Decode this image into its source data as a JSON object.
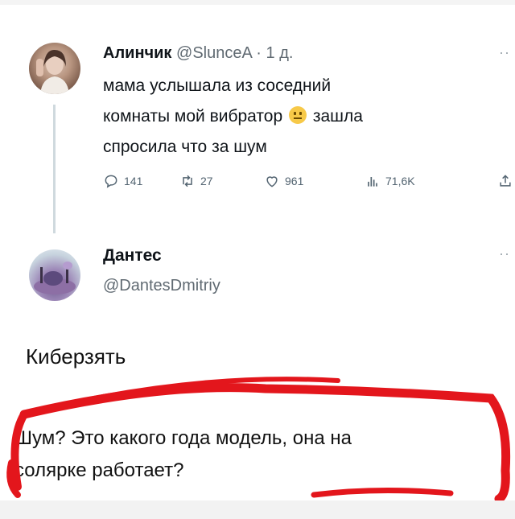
{
  "tweet": {
    "author_name": "Алинчик",
    "handle": "@SlunceA",
    "separator": "·",
    "time": "1 д.",
    "text_line1": "мама услышала из соседний",
    "text_line2_part1": "комнаты мой вибратор",
    "text_line2_part2": "зашла",
    "text_line3": "спросила что за шум",
    "emoji": "neutral-face-emoji",
    "more_label": "··",
    "stats": {
      "replies": "141",
      "retweets": "27",
      "likes": "961",
      "views": "71,6K"
    }
  },
  "reply": {
    "author_name": "Дантес",
    "handle": "@DantesDmitriy",
    "more_label": "··"
  },
  "comment": {
    "author": "Киберзять",
    "line1": "Шум? Это какого года модель, она на",
    "line2": "солярке работает?"
  },
  "colors": {
    "text": "#0f1419",
    "secondary": "#606a72",
    "icon": "#536471",
    "scribble": "#e3161c"
  }
}
